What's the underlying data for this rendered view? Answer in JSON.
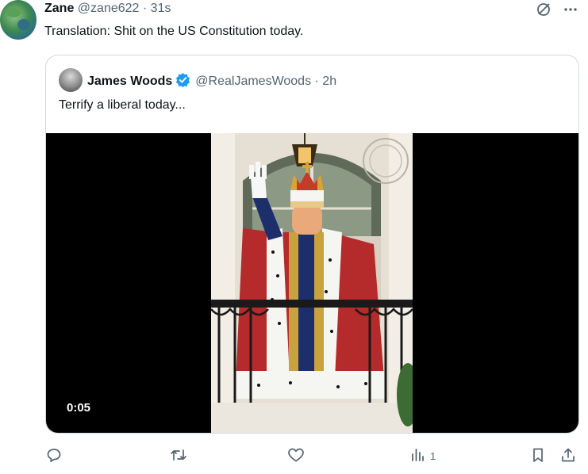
{
  "tweet": {
    "author_name": "Zane",
    "author_handle": "@zane622",
    "time": "31s",
    "text": "Translation: Shit on the US Constitution today."
  },
  "quoted": {
    "author_name": "James Woods",
    "author_handle": "@RealJamesWoods",
    "time": "2h",
    "text": "Terrify a liberal today...",
    "video_time": "0:05"
  },
  "actions": {
    "views": "1"
  },
  "icons": {
    "grok": "grok-icon",
    "more": "more-icon",
    "verified": "verified-badge-icon",
    "reply": "reply-icon",
    "repost": "repost-icon",
    "like": "like-icon",
    "views": "views-icon",
    "bookmark": "bookmark-icon",
    "share": "share-icon"
  },
  "colors": {
    "verified": "#1d9bf0",
    "text_secondary": "#536471",
    "border": "#cfd9de"
  }
}
